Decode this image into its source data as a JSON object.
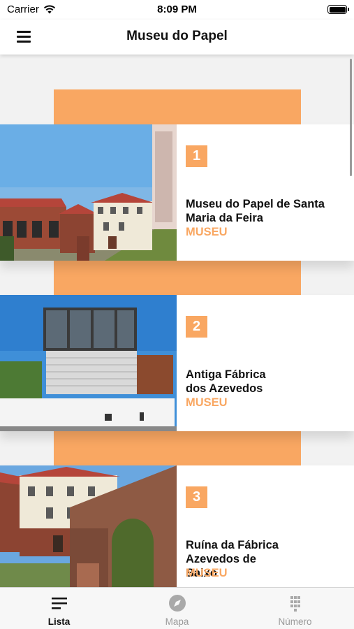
{
  "status_bar": {
    "carrier": "Carrier",
    "time": "8:09 PM"
  },
  "nav": {
    "title": "Museu do Papel"
  },
  "items": [
    {
      "number": "1",
      "title": "Museu do Papel de Santa Maria da Feira",
      "category": "MUSEU"
    },
    {
      "number": "2",
      "title": "Antiga Fábrica dos Azevedos",
      "category": "MUSEU"
    },
    {
      "number": "3",
      "title": "Ruína da Fábrica Azevedos de Baixo",
      "category": "MUSEU"
    }
  ],
  "tabs": [
    {
      "label": "Lista",
      "icon": "list-icon",
      "active": true
    },
    {
      "label": "Mapa",
      "icon": "compass-icon",
      "active": false
    },
    {
      "label": "Número",
      "icon": "keypad-icon",
      "active": false
    }
  ],
  "colors": {
    "accent": "#f9a762",
    "text": "#111111",
    "inactive": "#9a9a9a"
  }
}
